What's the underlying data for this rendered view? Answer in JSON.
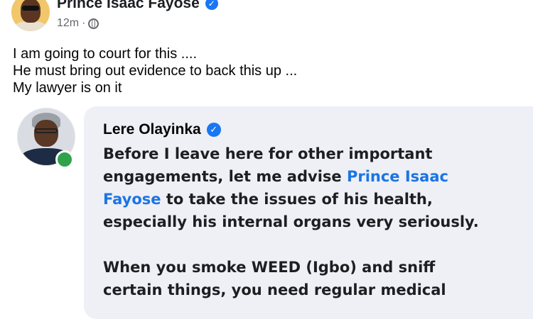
{
  "post": {
    "author": "Prince Isaac Fayose",
    "time": "12m",
    "separator": "·",
    "lines": [
      "I am going to court for this ....",
      "He must bring out evidence to back this up ...",
      "My lawyer is on it"
    ]
  },
  "quoted": {
    "author": "Lere Olayinka",
    "line1": "Before I leave here for other important",
    "line2": "engagements,  let me advise ",
    "mention1": "Prince Isaac",
    "mention2": "Fayose",
    "line3": " to take the issues of his health,",
    "line4": "especially his internal organs very seriously.",
    "line5": "When you smoke WEED (Igbo) and sniff",
    "line6": "certain things, you need regular medical"
  },
  "icons": {
    "verified": "verified-badge-icon",
    "globe": "globe-icon"
  },
  "colors": {
    "link": "#1b74e4",
    "verified": "#1877f2",
    "online": "#31a24c",
    "card": "#eef0f5"
  }
}
